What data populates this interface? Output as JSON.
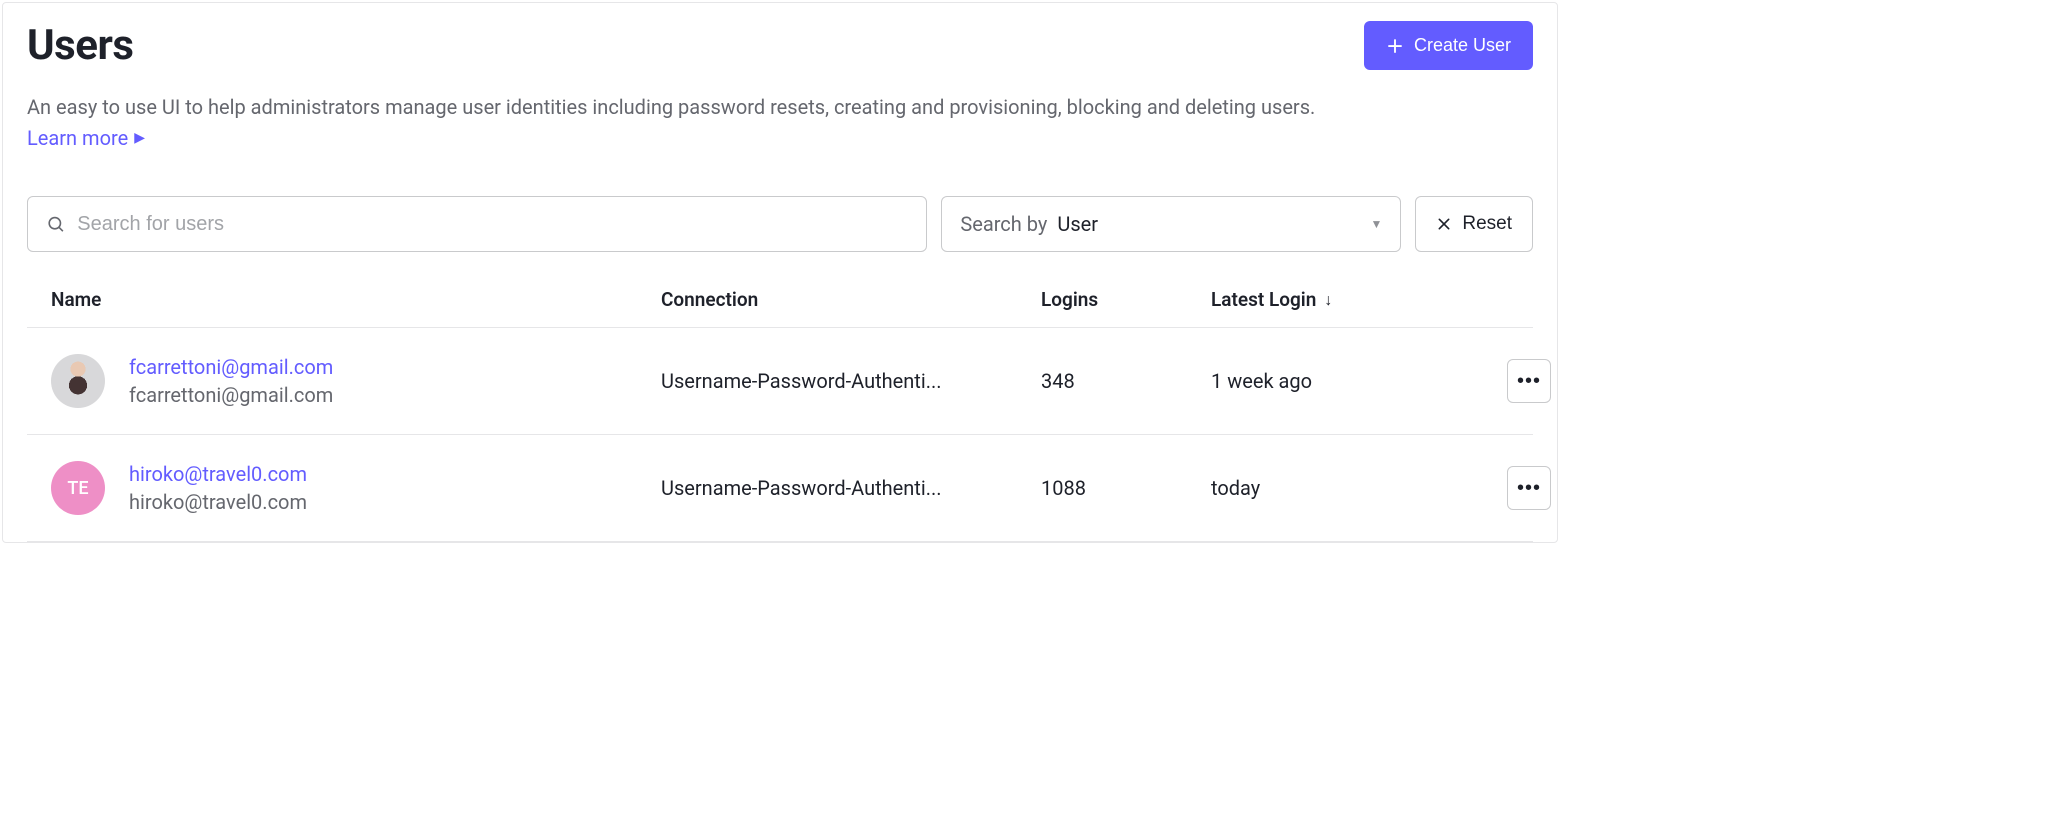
{
  "header": {
    "title": "Users",
    "create_button": "Create User",
    "description": "An easy to use UI to help administrators manage user identities including password resets, creating and provisioning, blocking and deleting users.",
    "learn_more": "Learn more"
  },
  "controls": {
    "search_placeholder": "Search for users",
    "search_by_label": "Search by",
    "search_by_value": "User",
    "reset": "Reset"
  },
  "table": {
    "columns": {
      "name": "Name",
      "connection": "Connection",
      "logins": "Logins",
      "latest_login": "Latest Login"
    },
    "rows": [
      {
        "avatar_type": "photo",
        "avatar_initials": "",
        "name": "fcarrettoni@gmail.com",
        "email": "fcarrettoni@gmail.com",
        "connection": "Username-Password-Authenti...",
        "logins": "348",
        "latest_login": "1 week ago"
      },
      {
        "avatar_type": "pink",
        "avatar_initials": "TE",
        "name": "hiroko@travel0.com",
        "email": "hiroko@travel0.com",
        "connection": "Username-Password-Authenti...",
        "logins": "1088",
        "latest_login": "today"
      }
    ]
  }
}
